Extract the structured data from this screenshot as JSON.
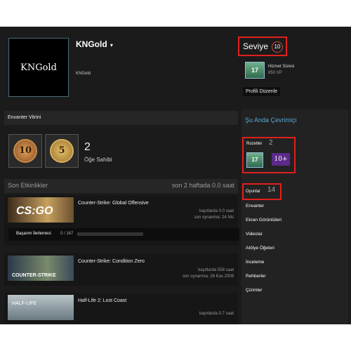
{
  "profile": {
    "avatar_text": "KNGold",
    "name": "KNGold",
    "subname": "KNGold"
  },
  "level": {
    "label": "Seviye",
    "value": "10"
  },
  "xp_badge": {
    "number": "17",
    "title": "Hizmet Süresi",
    "xp": "850 XP"
  },
  "edit_profile": "Profili Düzenle",
  "inventory": {
    "header": "Envanter Vitrini",
    "medal1": "10",
    "medal2": "5",
    "count": "2",
    "label": "Öğe Sahibi"
  },
  "activity": {
    "header": "Son Etkinlikler",
    "summary": "son 2 haftada 0.0 saat",
    "games": [
      {
        "name": "Counter-Strike: Global Offensive",
        "stat1": "kayıtlarda 0.0 saat",
        "stat2": "son oynanma: 24 Nis",
        "achievement_label": "Başarım İlerlemesi",
        "achievement_value": "0 / 167"
      },
      {
        "name": "Counter-Strike: Condition Zero",
        "stat1": "kayıtlarda 558 saat",
        "stat2": "son oynanma: 26 Kas 2009"
      },
      {
        "name": "Half-Life 2: Lost Coast",
        "stat1": "kayıtlarda 0.7 saat"
      }
    ]
  },
  "sidebar": {
    "online": "Şu Anda Çevrimiçi",
    "badges_label": "Rozetler",
    "badges_count": "2",
    "badge1": "17",
    "badge2": "10+",
    "games_label": "Oyunlar",
    "games_count": "14",
    "links": [
      "Envanter",
      "Ekran Görüntüleri",
      "Videolar",
      "Atölye Öğeleri",
      "İnceleme",
      "Rehberler",
      "Çizimler"
    ]
  },
  "colors": {
    "highlight": "#e0201c",
    "online": "#5aa9d6"
  }
}
